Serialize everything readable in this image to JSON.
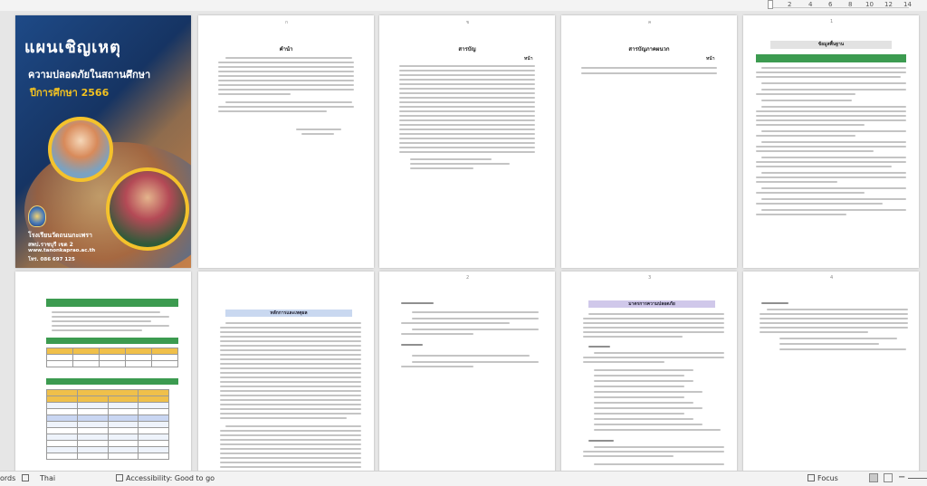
{
  "ruler": {
    "ticks": [
      "2",
      "4",
      "6",
      "8",
      "10",
      "12",
      "14"
    ]
  },
  "cover": {
    "title": "แผนเชิญเหตุ",
    "subtitle": "ความปลอดภัยในสถานศึกษา",
    "year": "ปีการศึกษา 2566",
    "school": "โรงเรียนวัดถนนกะเพรา",
    "area": "สพป.ราชบุรี เขต 2",
    "website": "www.tanonkaprao.ac.th",
    "phone": "โทร. 086 697 125"
  },
  "pages": {
    "foreword_title": "คำนำ",
    "toc_title": "สารบัญ",
    "toc_page_label": "หน้า",
    "appendix_title": "สารบัญภาคผนวก",
    "appendix_page_label": "หน้า",
    "basic_info_title": "ข้อมูลพื้นฐาน",
    "basic_info_section": "1. ข้อมูลทั่วไป",
    "general_title": "หลักการและเหตุผล",
    "purpose_title": "มาตรการความปลอดภัย",
    "page_numbers": [
      "ก",
      "ข",
      "ค",
      "1",
      "2",
      "3",
      "4",
      "5",
      "6"
    ]
  },
  "status": {
    "words_label": "ords",
    "language": "Thai",
    "accessibility": "Accessibility: Good to go",
    "focus": "Focus"
  }
}
